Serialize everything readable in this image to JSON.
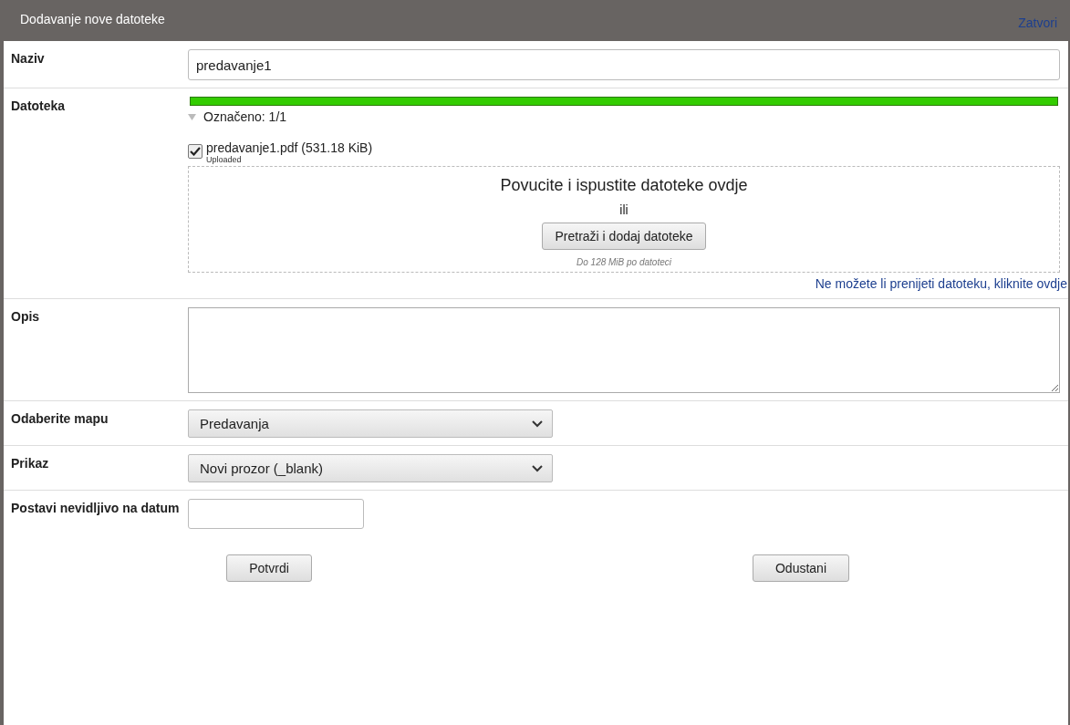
{
  "window": {
    "title": "Dodavanje nove datoteke",
    "close_link": "Zatvori"
  },
  "fields": [
    {
      "kind": "text",
      "label": "Naziv",
      "value": "predavanje1"
    },
    {
      "kind": "upload",
      "label": "Datoteka",
      "level": 1.0,
      "selection_summary": "Označeno: 1/1",
      "files": [
        {
          "name": "predavanje1.pdf (531.18 KiB)",
          "status": "Uploaded",
          "checked": true
        }
      ],
      "drop_text": "Povucite i ispustite datoteke ovdje",
      "or_text": "ili",
      "browse_button": "Pretraži i dodaj datoteke",
      "size_limit": "Do 128 MiB po datoteci",
      "fallback_link": "Ne možete li prenijeti datoteku, kliknite ovdje"
    },
    {
      "kind": "textarea",
      "label": "Opis"
    },
    {
      "kind": "select",
      "label": "Odaberite mapu",
      "value": "Predavanja"
    },
    {
      "kind": "select",
      "label": "Prikaz",
      "value": "Novi prozor (_blank)"
    },
    {
      "kind": "date",
      "label": "Postavi nevidljivo na datum"
    }
  ],
  "buttons": [
    "Potvrdi",
    "Odustani"
  ]
}
